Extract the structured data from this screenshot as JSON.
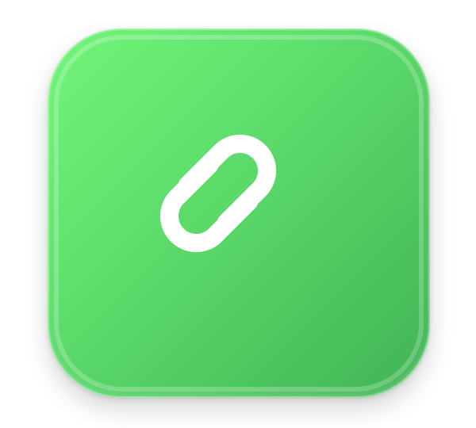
{
  "icon": {
    "name": "link-icon",
    "background_colors": [
      "#73f57a",
      "#5fdf6d",
      "#4fc860",
      "#42b356"
    ],
    "glyph_color": "#ffffff"
  }
}
